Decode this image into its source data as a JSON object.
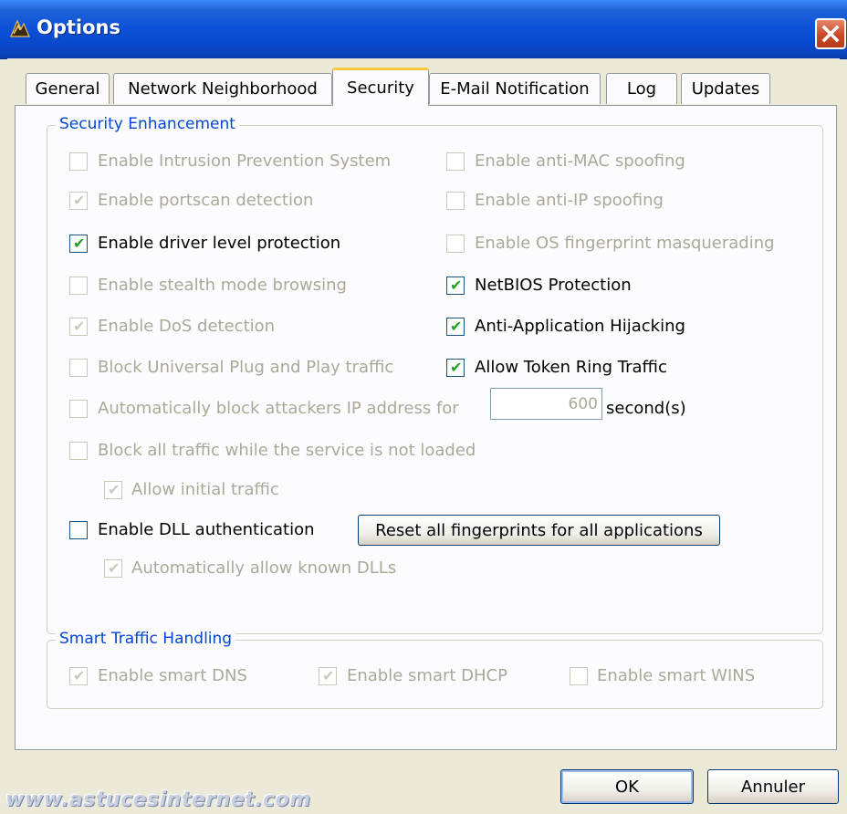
{
  "window": {
    "title": "Options",
    "close_glyph": "✕"
  },
  "tabs": [
    {
      "label": "General",
      "active": false
    },
    {
      "label": "Network Neighborhood",
      "active": false
    },
    {
      "label": "Security",
      "active": true
    },
    {
      "label": "E-Mail Notification",
      "active": false
    },
    {
      "label": "Log",
      "active": false
    },
    {
      "label": "Updates",
      "active": false
    }
  ],
  "security_enhancement": {
    "title": "Security Enhancement",
    "options": {
      "ips": {
        "label": "Enable Intrusion Prevention System",
        "checked": false,
        "enabled": false
      },
      "portscan": {
        "label": "Enable portscan detection",
        "checked": true,
        "enabled": false
      },
      "driver": {
        "label": "Enable driver level protection",
        "checked": true,
        "enabled": true
      },
      "stealth": {
        "label": "Enable stealth mode browsing",
        "checked": false,
        "enabled": false
      },
      "dos": {
        "label": "Enable DoS detection",
        "checked": true,
        "enabled": false
      },
      "upnp": {
        "label": "Block Universal Plug and Play traffic",
        "checked": false,
        "enabled": false
      },
      "antimac": {
        "label": "Enable anti-MAC spoofing",
        "checked": false,
        "enabled": false
      },
      "antiip": {
        "label": "Enable anti-IP spoofing",
        "checked": false,
        "enabled": false
      },
      "osfp": {
        "label": "Enable OS fingerprint masquerading",
        "checked": false,
        "enabled": false
      },
      "netbios": {
        "label": "NetBIOS Protection",
        "checked": true,
        "enabled": true
      },
      "hijack": {
        "label": "Anti-Application Hijacking",
        "checked": true,
        "enabled": true
      },
      "tokenring": {
        "label": "Allow Token Ring Traffic",
        "checked": true,
        "enabled": true
      },
      "blockattacker": {
        "label": "Automatically block attackers IP address for",
        "checked": false,
        "enabled": false
      },
      "blockall": {
        "label": "Block all traffic while the service is not loaded",
        "checked": false,
        "enabled": false
      },
      "initial": {
        "label": "Allow initial traffic",
        "checked": true,
        "enabled": false
      },
      "dll": {
        "label": "Enable DLL authentication",
        "checked": false,
        "enabled": true
      },
      "knowndll": {
        "label": "Automatically allow known DLLs",
        "checked": true,
        "enabled": false
      }
    },
    "block_seconds_value": "600",
    "seconds_unit": "second(s)",
    "reset_button": "Reset all fingerprints for all applications"
  },
  "smart_traffic": {
    "title": "Smart Traffic Handling",
    "options": {
      "dns": {
        "label": "Enable smart DNS",
        "checked": true,
        "enabled": false
      },
      "dhcp": {
        "label": "Enable smart DHCP",
        "checked": true,
        "enabled": false
      },
      "wins": {
        "label": "Enable smart WINS",
        "checked": false,
        "enabled": false
      }
    }
  },
  "buttons": {
    "ok": "OK",
    "cancel": "Annuler"
  },
  "watermark": "www.astucesinternet.com",
  "check_glyph": "✔",
  "colors": {
    "titlebar": "#0a47c8",
    "group_title": "#0046d5",
    "check": "#21a121",
    "disabled": "#aca899",
    "close": "#c94a28"
  }
}
